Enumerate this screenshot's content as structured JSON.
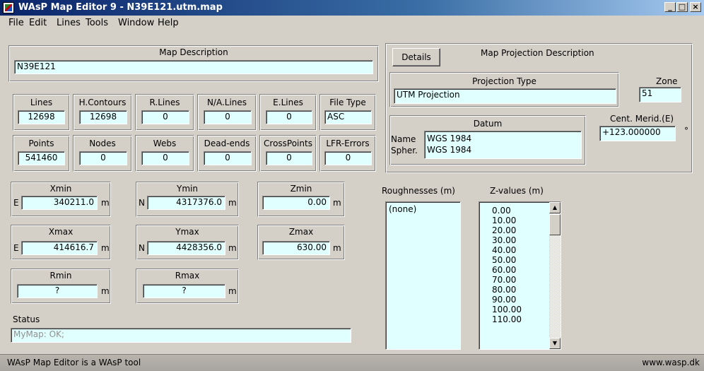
{
  "window": {
    "title": "WAsP Map Editor 9 - N39E121.utm.map",
    "minimize": "_",
    "maximize": "□",
    "close": "×"
  },
  "menu": [
    "File",
    "Edit",
    "Lines",
    "Tools",
    "Window",
    "Help"
  ],
  "map_description": {
    "caption": "Map Description",
    "value": "N39E121"
  },
  "counts_row1": [
    {
      "label": "Lines",
      "value": "12698"
    },
    {
      "label": "H.Contours",
      "value": "12698"
    },
    {
      "label": "R.Lines",
      "value": "0"
    },
    {
      "label": "N/A.Lines",
      "value": "0"
    },
    {
      "label": "E.Lines",
      "value": "0"
    },
    {
      "label": "File Type",
      "value": "ASC"
    }
  ],
  "counts_row2": [
    {
      "label": "Points",
      "value": "541460"
    },
    {
      "label": "Nodes",
      "value": "0"
    },
    {
      "label": "Webs",
      "value": "0"
    },
    {
      "label": "Dead-ends",
      "value": "0"
    },
    {
      "label": "CrossPoints",
      "value": "0"
    },
    {
      "label": "LFR-Errors",
      "value": "0"
    }
  ],
  "extents": {
    "xmin": {
      "label": "Xmin",
      "prefix": "E",
      "value": "340211.0",
      "unit": "m"
    },
    "ymin": {
      "label": "Ymin",
      "prefix": "N",
      "value": "4317376.0",
      "unit": "m"
    },
    "zmin": {
      "label": "Zmin",
      "value": "0.00",
      "unit": "m"
    },
    "xmax": {
      "label": "Xmax",
      "prefix": "E",
      "value": "414616.7",
      "unit": "m"
    },
    "ymax": {
      "label": "Ymax",
      "prefix": "N",
      "value": "4428356.0",
      "unit": "m"
    },
    "zmax": {
      "label": "Zmax",
      "value": "630.00",
      "unit": "m"
    },
    "rmin": {
      "label": "Rmin",
      "value": "?",
      "unit": "m"
    },
    "rmax": {
      "label": "Rmax",
      "value": "?",
      "unit": "m"
    }
  },
  "status": {
    "label": "Status",
    "value": "MyMap: OK;"
  },
  "projection": {
    "details_button": "Details",
    "caption": "Map Projection Description",
    "type_caption": "Projection Type",
    "type_value": "UTM Projection",
    "zone_label": "Zone",
    "zone_value": "51",
    "datum_caption": "Datum",
    "name_label": "Name",
    "name_value": "WGS 1984",
    "spher_label": "Spher.",
    "spher_value": "WGS 1984",
    "cent_merid_label": "Cent. Merid.(E)",
    "cent_merid_value": "+123.000000",
    "degree_symbol": "°"
  },
  "roughnesses": {
    "label": "Roughnesses (m)",
    "items": [
      "(none)"
    ]
  },
  "zvalues": {
    "label": "Z-values (m)",
    "items": [
      "0.00",
      "10.00",
      "20.00",
      "30.00",
      "40.00",
      "50.00",
      "60.00",
      "70.00",
      "80.00",
      "90.00",
      "100.00",
      "110.00"
    ]
  },
  "statusbar": {
    "left": "WAsP Map Editor is a WAsP tool",
    "right": "www.wasp.dk"
  }
}
